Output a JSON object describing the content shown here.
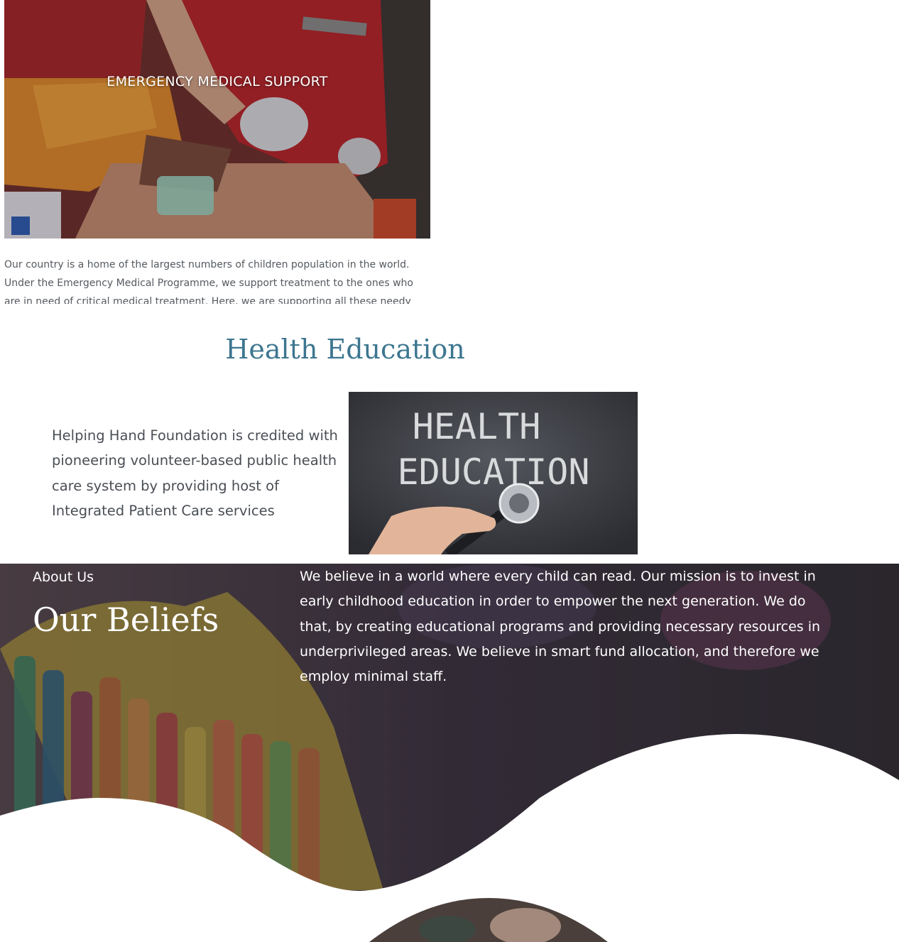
{
  "emergency": {
    "title": "EMERGENCY MEDICAL SUPPORT",
    "description": "Our country is a home of the largest numbers of children population in the world. Under the Emergency Medical Programme, we support treatment to the ones who are in need of critical medical treatment. Here, we are supporting all these needy"
  },
  "health_education": {
    "heading": "Health Education",
    "text": "Helping Hand Foundation is credited with pioneering volunteer-based public health care system by providing host of Integrated Patient Care services",
    "image_text_line1": "HEALTH",
    "image_text_line2": "EDUCATION"
  },
  "beliefs": {
    "label": "About Us",
    "title": "Our Beliefs",
    "text": "We believe in a world where every child can read. Our mission is to invest in early childhood education in order to empower the next generation. We do that, by creating educational programs and providing necessary resources in underprivileged areas. We believe in smart fund allocation, and therefore we employ minimal staff."
  },
  "colors": {
    "heading_blue": "#3d7690",
    "body_text": "#4a4f55",
    "overlay_dark": "#2e2a33"
  }
}
